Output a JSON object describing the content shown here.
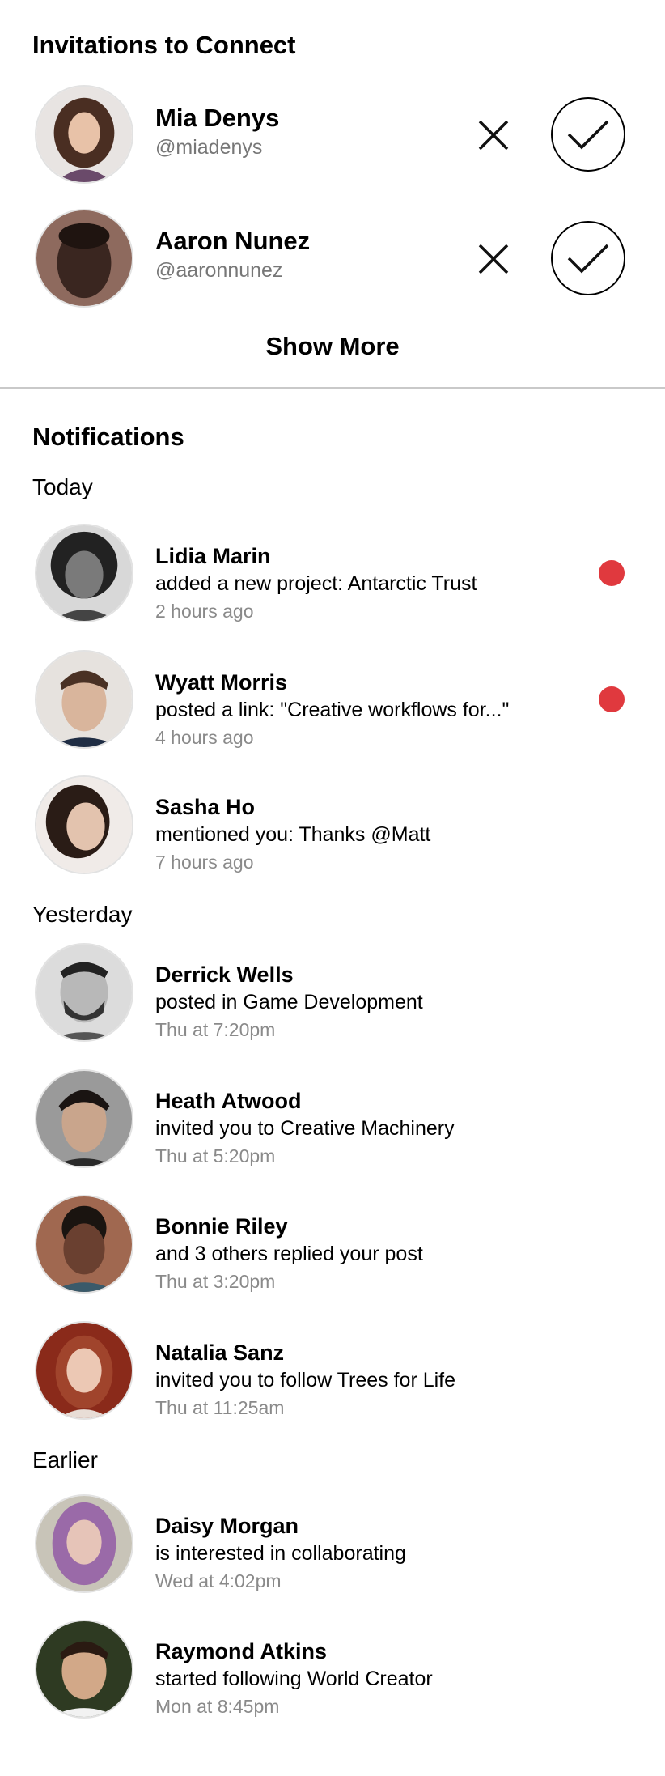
{
  "invitations": {
    "title": "Invitations to Connect",
    "items": [
      {
        "name": "Mia Denys",
        "handle": "@miadenys"
      },
      {
        "name": "Aaron Nunez",
        "handle": "@aaronnunez"
      }
    ],
    "show_more_label": "Show More",
    "decline_icon": "close-icon",
    "accept_icon": "check-icon"
  },
  "notifications": {
    "title": "Notifications",
    "groups": [
      {
        "label": "Today",
        "items": [
          {
            "name": "Lidia Marin",
            "text": "added a new project: Antarctic Trust",
            "time": "2 hours ago",
            "unread": true
          },
          {
            "name": "Wyatt Morris",
            "text": "posted a link: \"Creative workflows for...\"",
            "time": "4 hours ago",
            "unread": true
          },
          {
            "name": "Sasha Ho",
            "text": "mentioned you: Thanks @Matt",
            "time": "7 hours ago",
            "unread": false
          }
        ]
      },
      {
        "label": "Yesterday",
        "items": [
          {
            "name": "Derrick Wells",
            "text": "posted in Game Development",
            "time": "Thu at 7:20pm",
            "unread": false
          },
          {
            "name": "Heath Atwood",
            "text": "invited you to Creative Machinery",
            "time": "Thu at 5:20pm",
            "unread": false
          },
          {
            "name": "Bonnie Riley",
            "text": "and 3 others replied your post",
            "time": "Thu at 3:20pm",
            "unread": false
          },
          {
            "name": "Natalia Sanz",
            "text": "invited you to follow Trees for Life",
            "time": "Thu at 11:25am",
            "unread": false
          }
        ]
      },
      {
        "label": "Earlier",
        "items": [
          {
            "name": "Daisy Morgan",
            "text": "is interested in collaborating",
            "time": "Wed at 4:02pm",
            "unread": false
          },
          {
            "name": "Raymond Atkins",
            "text": "started following World Creator",
            "time": "Mon at 8:45pm",
            "unread": false
          }
        ]
      }
    ]
  },
  "colors": {
    "unread_dot": "#e0393e",
    "divider": "#c9c9c9",
    "secondary_text": "#777777"
  }
}
